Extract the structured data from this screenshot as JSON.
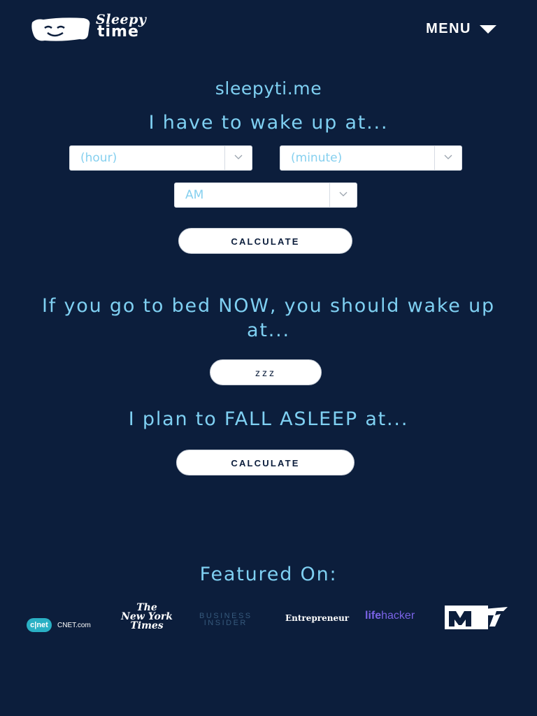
{
  "header": {
    "logo_line1": "Sleepy",
    "logo_line2": "time",
    "menu_label": "MENU"
  },
  "main": {
    "site_name": "sleepyti.me",
    "wake_heading": "I have to wake up at...",
    "hour_select": {
      "selected": "(hour)"
    },
    "minute_select": {
      "selected": "(minute)"
    },
    "ampm_select": {
      "selected": "AM"
    },
    "calculate_label": "CALCULATE",
    "bed_now_heading": "If you go to bed NOW, you should wake up at...",
    "zzz_label": "zzz",
    "fall_asleep_heading": "I plan to FALL ASLEEP at...",
    "calculate2_label": "CALCULATE"
  },
  "featured": {
    "heading": "Featured On:",
    "logos": {
      "cnet_badge": "c|net",
      "cnet_text": "CNET.com",
      "nyt_line1": "The",
      "nyt_line2": "New York",
      "nyt_line3": "Times",
      "bi_line1": "BUSINESS",
      "bi_line2": "INSIDER",
      "entrepreneur": "Entrepreneur",
      "lifehacker_a": "life",
      "lifehacker_b": "hacker",
      "mtv": "MTV"
    }
  },
  "colors": {
    "background": "#0c1e3c",
    "accent_text": "#7fd0f2",
    "button_bg": "#ffffff",
    "button_text": "#0c1e3c"
  }
}
